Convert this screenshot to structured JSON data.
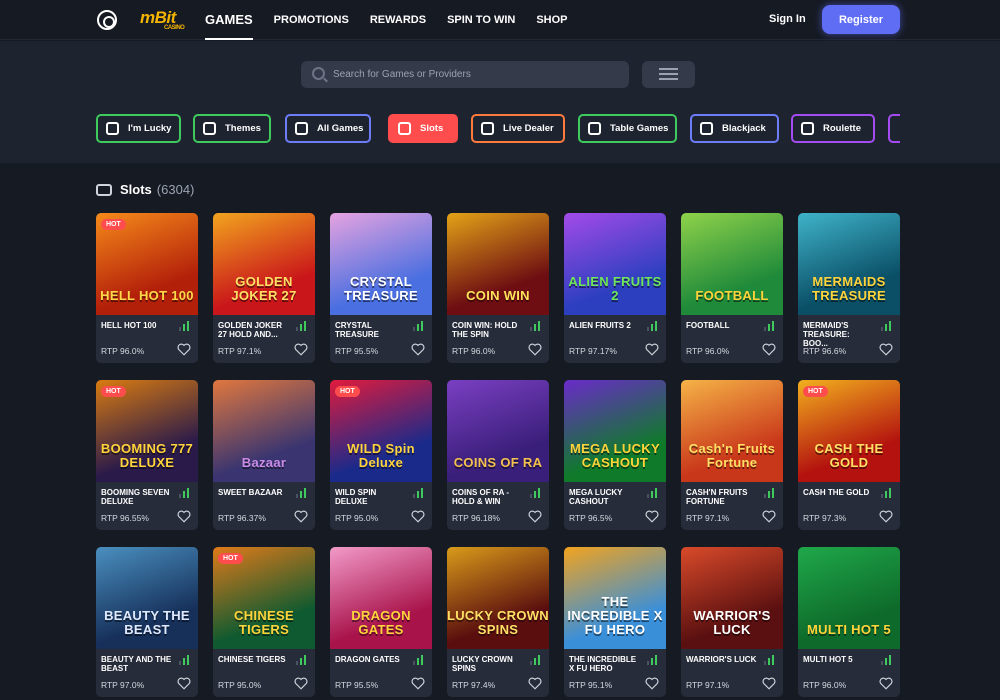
{
  "header": {
    "brand": "mBit",
    "brand_sub": "CASINO",
    "nav": [
      {
        "label": "GAMES",
        "active": true
      },
      {
        "label": "PROMOTIONS",
        "active": false
      },
      {
        "label": "REWARDS",
        "active": false
      },
      {
        "label": "SPIN TO WIN",
        "active": false
      },
      {
        "label": "SHOP",
        "active": false
      }
    ],
    "signin_label": "Sign In",
    "register_label": "Register"
  },
  "search": {
    "placeholder": "Search for Games or Providers"
  },
  "categories": [
    {
      "label": "I'm Lucky",
      "icon": "clover-icon",
      "color": "#3fca5d",
      "active": false
    },
    {
      "label": "Themes",
      "icon": "theme-icon",
      "color": "#3fca5d",
      "active": false
    },
    {
      "label": "All Games",
      "icon": "dice-icon",
      "color": "#6d7cf7",
      "active": false
    },
    {
      "label": "Slots",
      "icon": "slot-machine-icon",
      "color": "#ff4d4d",
      "active": true
    },
    {
      "label": "Live Dealer",
      "icon": "dealer-icon",
      "color": "#ff7a3d",
      "active": false
    },
    {
      "label": "Table Games",
      "icon": "table-icon",
      "color": "#3fca5d",
      "active": false
    },
    {
      "label": "Blackjack",
      "icon": "cards-icon",
      "color": "#6d7cf7",
      "active": false
    },
    {
      "label": "Roulette",
      "icon": "roulette-icon",
      "color": "#a44bf2",
      "active": false
    }
  ],
  "section": {
    "title": "Slots",
    "count": "(6304)"
  },
  "games": [
    {
      "name": "HELL HOT 100",
      "rtp": "RTP 96.0%",
      "hot": true,
      "art": "HELL HOT 100",
      "bg": "#b3200a",
      "bg2": "#f58a1a",
      "fg": "#ffd84a"
    },
    {
      "name": "GOLDEN JOKER 27 HOLD AND...",
      "rtp": "RTP 97.1%",
      "hot": false,
      "art": "GOLDEN JOKER 27",
      "bg": "#c9161a",
      "bg2": "#f2a51e",
      "fg": "#ffe066"
    },
    {
      "name": "CRYSTAL TREASURE",
      "rtp": "RTP 95.5%",
      "hot": false,
      "art": "CRYSTAL TREASURE",
      "bg": "#4a6fe0",
      "bg2": "#e6a3e0",
      "fg": "#ffffff"
    },
    {
      "name": "COIN WIN: HOLD THE SPIN",
      "rtp": "RTP 96.0%",
      "hot": false,
      "art": "COIN WIN",
      "bg": "#6e0e12",
      "bg2": "#e3a317",
      "fg": "#ffe35a"
    },
    {
      "name": "ALIEN FRUITS 2",
      "rtp": "RTP 97.17%",
      "hot": false,
      "art": "ALIEN FRUITS 2",
      "bg": "#2b3fbf",
      "bg2": "#a34be8",
      "fg": "#6ee65a"
    },
    {
      "name": "FOOTBALL",
      "rtp": "RTP 96.0%",
      "hot": false,
      "art": "FOOTBALL",
      "bg": "#1f8a3a",
      "bg2": "#8fd24a",
      "fg": "#ffd43b"
    },
    {
      "name": "MERMAID'S TREASURE: BOO...",
      "rtp": "RTP 96.6%",
      "hot": false,
      "art": "MERMAIDS TREASURE",
      "bg": "#0a4f66",
      "bg2": "#3fb3c9",
      "fg": "#ffd43b"
    },
    {
      "name": "BOOMING SEVEN DELUXE",
      "rtp": "RTP 96.55%",
      "hot": true,
      "art": "BOOMING 777 DELUXE",
      "bg": "#2a1a4a",
      "bg2": "#d97b10",
      "fg": "#ffd43b"
    },
    {
      "name": "SWEET BAZAAR",
      "rtp": "RTP 96.37%",
      "hot": false,
      "art": "Bazaar",
      "bg": "#3a3570",
      "bg2": "#e0773e",
      "fg": "#c98be6"
    },
    {
      "name": "WILD SPIN DELUXE",
      "rtp": "RTP 95.0%",
      "hot": true,
      "art": "WILD Spin Deluxe",
      "bg": "#1a2a8a",
      "bg2": "#e11b3c",
      "fg": "#ffd43b"
    },
    {
      "name": "COINS OF RA - HOLD & WIN",
      "rtp": "RTP 96.18%",
      "hot": false,
      "art": "COINS OF RA",
      "bg": "#3a1f7a",
      "bg2": "#7a3fc2",
      "fg": "#f2c14e"
    },
    {
      "name": "MEGA LUCKY CASHOUT",
      "rtp": "RTP 96.5%",
      "hot": false,
      "art": "MEGA LUCKY CASHOUT",
      "bg": "#0f7a2a",
      "bg2": "#6a2ac9",
      "fg": "#ffd43b"
    },
    {
      "name": "CASH'N FRUITS FORTUNE",
      "rtp": "RTP 97.1%",
      "hot": false,
      "art": "Cash'n Fruits Fortune",
      "bg": "#c9371a",
      "bg2": "#f5b347",
      "fg": "#ffe066"
    },
    {
      "name": "CASH THE GOLD",
      "rtp": "RTP 97.3%",
      "hot": true,
      "art": "CASH THE GOLD",
      "bg": "#b3120e",
      "bg2": "#f2b01e",
      "fg": "#ffe066"
    },
    {
      "name": "BEAUTY AND THE BEAST",
      "rtp": "RTP 97.0%",
      "hot": false,
      "art": "BEAUTY THE BEAST",
      "bg": "#16305a",
      "bg2": "#4a8fbf",
      "fg": "#dfe9ff"
    },
    {
      "name": "CHINESE TIGERS",
      "rtp": "RTP 95.0%",
      "hot": true,
      "art": "CHINESE TIGERS",
      "bg": "#0f5a30",
      "bg2": "#e07a1a",
      "fg": "#ffd43b"
    },
    {
      "name": "DRAGON GATES",
      "rtp": "RTP 95.5%",
      "hot": false,
      "art": "DRAGON GATES",
      "bg": "#a8134a",
      "bg2": "#f29ac9",
      "fg": "#ffd43b"
    },
    {
      "name": "LUCKY CROWN SPINS",
      "rtp": "RTP 97.4%",
      "hot": false,
      "art": "LUCKY CROWN SPINS",
      "bg": "#5a0e0e",
      "bg2": "#d99b1a",
      "fg": "#ffe066"
    },
    {
      "name": "THE INCREDIBLE X FU HERO",
      "rtp": "RTP 95.1%",
      "hot": false,
      "art": "THE INCREDIBLE X FU HERO",
      "bg": "#3a8fd9",
      "bg2": "#f2a31e",
      "fg": "#ffffff"
    },
    {
      "name": "WARRIOR'S LUCK",
      "rtp": "RTP 97.1%",
      "hot": false,
      "art": "WARRIOR'S LUCK",
      "bg": "#5a1010",
      "bg2": "#d94a2a",
      "fg": "#ffffff"
    },
    {
      "name": "MULTI HOT 5",
      "rtp": "RTP 96.0%",
      "hot": false,
      "art": "MULTI HOT 5",
      "bg": "#0e6a2a",
      "bg2": "#1fa84a",
      "fg": "#ffd43b"
    }
  ],
  "labels": {
    "hot": "HOT"
  }
}
